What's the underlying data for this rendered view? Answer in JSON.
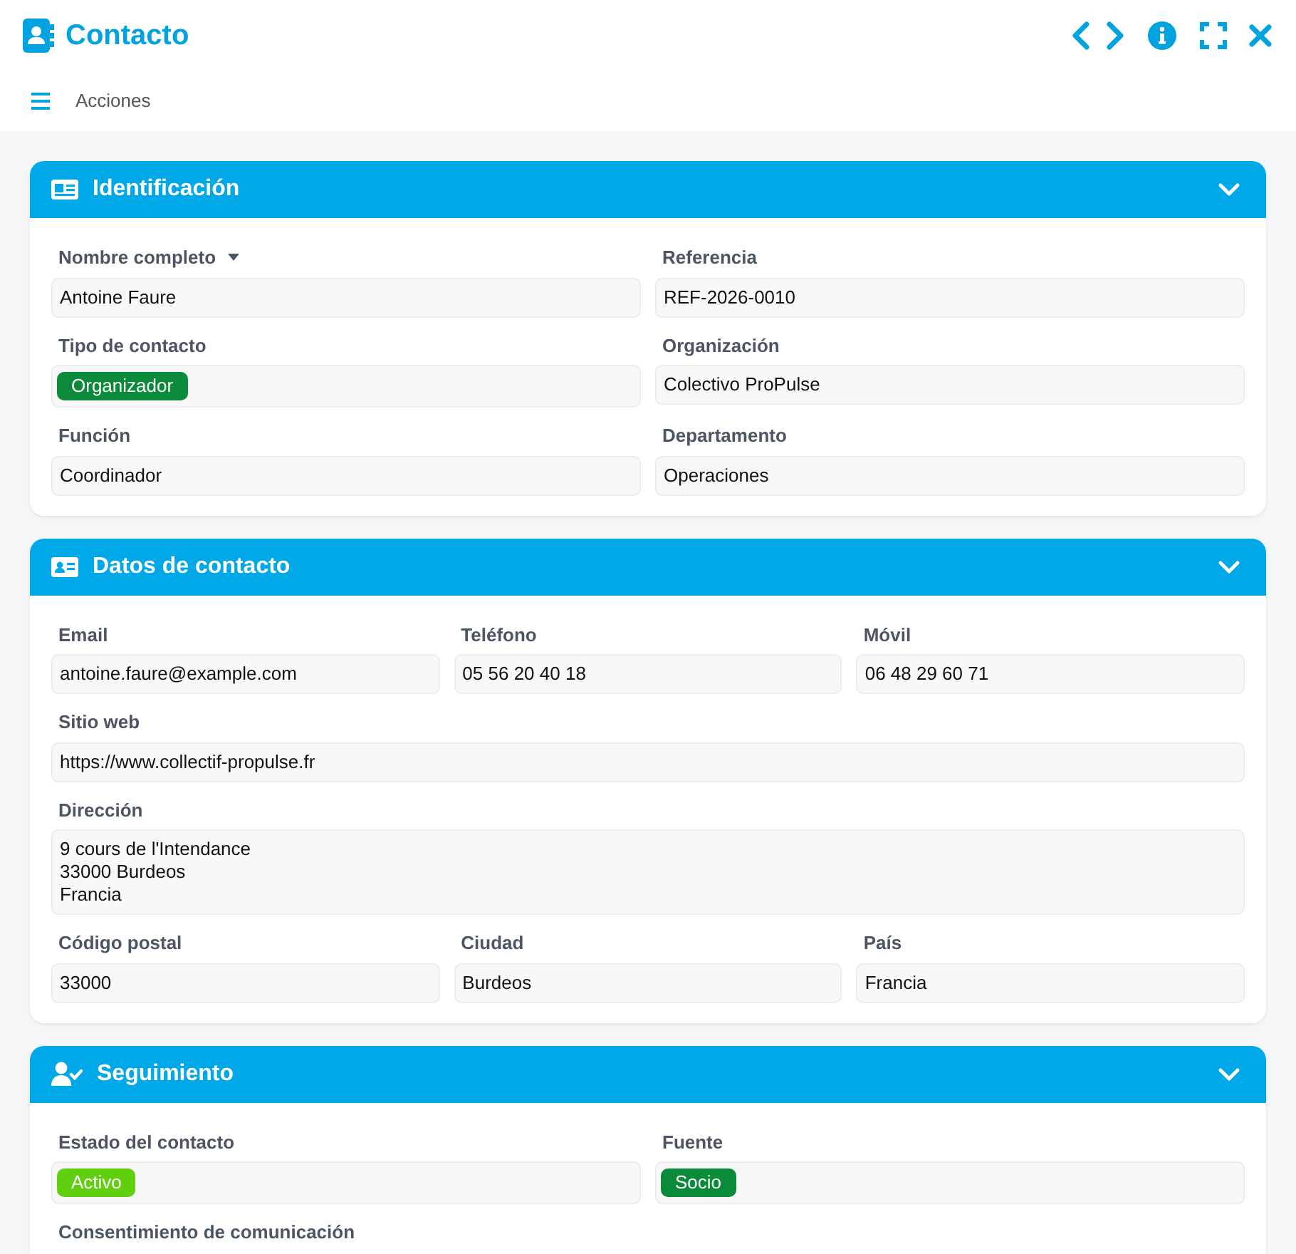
{
  "window": {
    "title": "Contacto"
  },
  "toolbar": {
    "menu_label": "Acciones"
  },
  "sections": [
    {
      "title": "Identificación",
      "expanded": true,
      "rows": [
        [
          {
            "label": "Nombre completo",
            "sortable": true,
            "kind": "text",
            "value": "Antoine Faure"
          },
          {
            "label": "Referencia",
            "kind": "text",
            "value": "REF-2026-0010"
          }
        ],
        [
          {
            "label": "Tipo de contacto",
            "kind": "tag",
            "value": "Organizador",
            "color": "#0b8a3a"
          },
          {
            "label": "Organización",
            "kind": "text",
            "value": "Colectivo ProPulse"
          }
        ],
        [
          {
            "label": "Función",
            "kind": "text",
            "value": "Coordinador"
          },
          {
            "label": "Departamento",
            "kind": "text",
            "value": "Operaciones"
          }
        ]
      ]
    },
    {
      "title": "Datos de contacto",
      "expanded": true,
      "rows": [
        [
          {
            "label": "Email",
            "kind": "text",
            "value": "antoine.faure@example.com"
          },
          {
            "label": "Teléfono",
            "kind": "text",
            "value": "05 56 20 40 18"
          },
          {
            "label": "Móvil",
            "kind": "text",
            "value": "06 48 29 60 71"
          }
        ],
        [
          {
            "label": "Sitio web",
            "kind": "text",
            "value": "https://www.collectif-propulse.fr"
          }
        ],
        [
          {
            "label": "Dirección",
            "kind": "multiline",
            "value": "9 cours de l'Intendance\n33000 Burdeos\nFrancia"
          }
        ],
        [
          {
            "label": "Código postal",
            "kind": "text",
            "value": "33000"
          },
          {
            "label": "Ciudad",
            "kind": "text",
            "value": "Burdeos"
          },
          {
            "label": "País",
            "kind": "text",
            "value": "Francia"
          }
        ]
      ]
    },
    {
      "title": "Seguimiento",
      "expanded": true,
      "rows": [
        [
          {
            "label": "Estado del contacto",
            "kind": "tag",
            "value": "Activo",
            "color": "#5fcf0f"
          },
          {
            "label": "Fuente",
            "kind": "tag",
            "value": "Socio",
            "color": "#0b8a3a"
          }
        ],
        [
          {
            "label": "Consentimiento de comunicación",
            "kind": "label_only"
          }
        ]
      ]
    }
  ]
}
